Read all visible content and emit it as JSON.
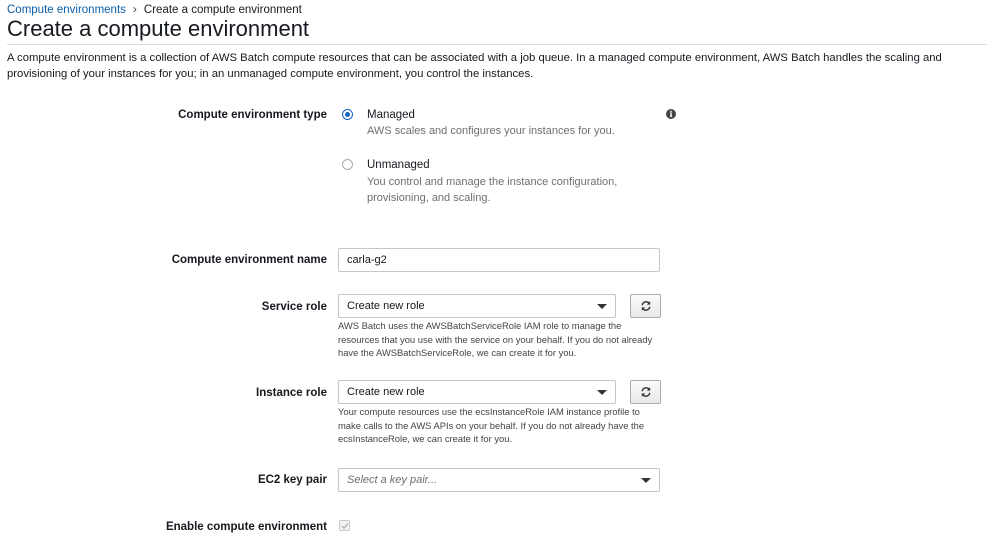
{
  "breadcrumb": {
    "parent": "Compute environments",
    "separator": "›",
    "current": "Create a compute environment"
  },
  "page": {
    "title": "Create a compute environment",
    "description": "A compute environment is a collection of AWS Batch compute resources that can be associated with a job queue. In a managed compute environment, AWS Batch handles the scaling and provisioning of your instances for you; in an unmanaged compute environment, you control the instances."
  },
  "env_type": {
    "label": "Compute environment type",
    "info_icon": "info-icon",
    "options": [
      {
        "label": "Managed",
        "help": "AWS scales and configures your instances for you.",
        "selected": true
      },
      {
        "label": "Unmanaged",
        "help": "You control and manage the instance configuration, provisioning, and scaling.",
        "selected": false
      }
    ]
  },
  "env_name": {
    "label": "Compute environment name",
    "value": "carla-g2"
  },
  "service_role": {
    "label": "Service role",
    "value": "Create new role",
    "help": "AWS Batch uses the AWSBatchServiceRole IAM role to manage the resources that you use with the service on your behalf. If you do not already have the AWSBatchServiceRole, we can create it for you."
  },
  "instance_role": {
    "label": "Instance role",
    "value": "Create new role",
    "help": "Your compute resources use the ecsInstanceRole IAM instance profile to make calls to the AWS APIs on your behalf. If you do not already have the ecsInstanceRole, we can create it for you."
  },
  "key_pair": {
    "label": "EC2 key pair",
    "placeholder": "Select a key pair..."
  },
  "enable_env": {
    "label": "Enable compute environment",
    "checked": true
  },
  "colors": {
    "link": "#0a5ea8",
    "radio_selected": "#1565c0",
    "help_text": "#6f6f6f"
  }
}
